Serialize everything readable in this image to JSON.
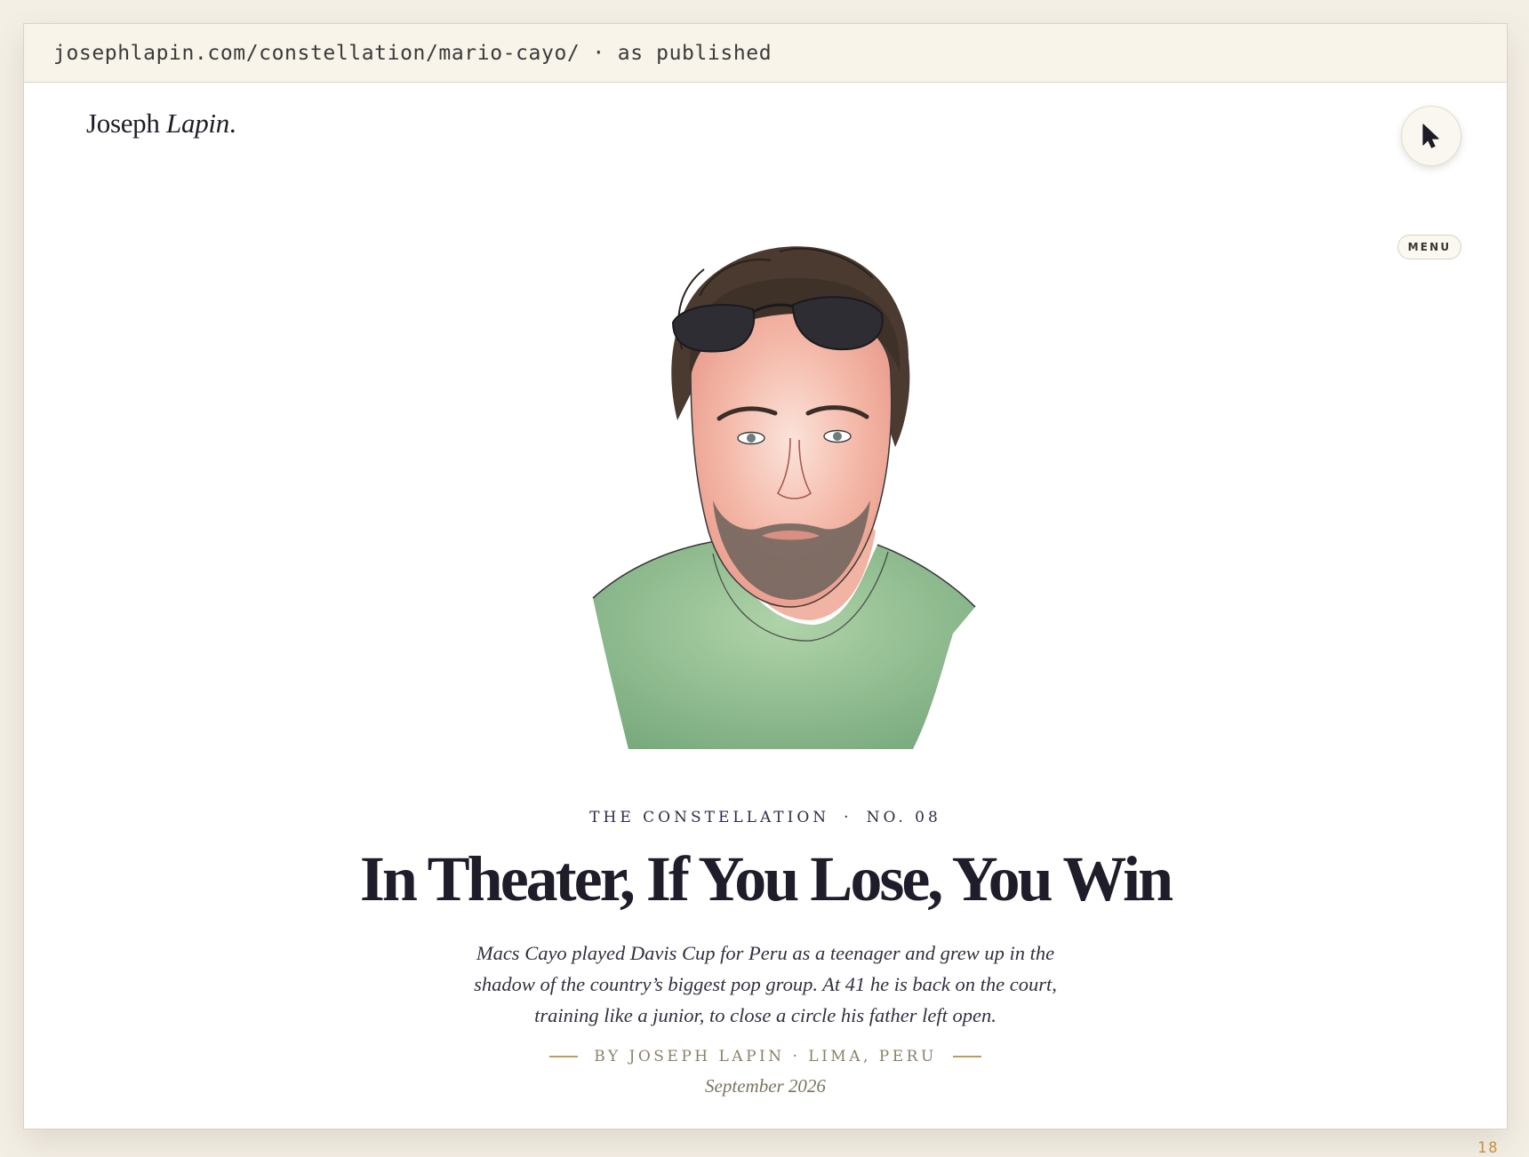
{
  "browser": {
    "url": "josephlapin.com/constellation/mario-cayo/",
    "separator": "·",
    "status": "as published"
  },
  "site": {
    "logo_first": "Joseph",
    "logo_last": "Lapin",
    "logo_dot": "."
  },
  "nav": {
    "menu_label": "MENU",
    "cursor_icon": "cursor-arrow-icon"
  },
  "article": {
    "series": "THE CONSTELLATION",
    "kicker_separator": "·",
    "issue": "NO. 08",
    "title": "In Theater, If You Lose, You Win",
    "dek": "Macs Cayo played Davis Cup for Peru as a teenager and grew up in the shadow of the country’s biggest pop group. At 41 he is back on the court, training like a junior, to close a circle his father left open.",
    "byline": "BY JOSEPH LAPIN · LIMA, PERU",
    "date": "September 2026"
  },
  "colors": {
    "accent_rule": "#c19a5b",
    "kicker": "#2a2d4a",
    "page_number": "#c7913f"
  },
  "footer": {
    "page_number": "18"
  }
}
